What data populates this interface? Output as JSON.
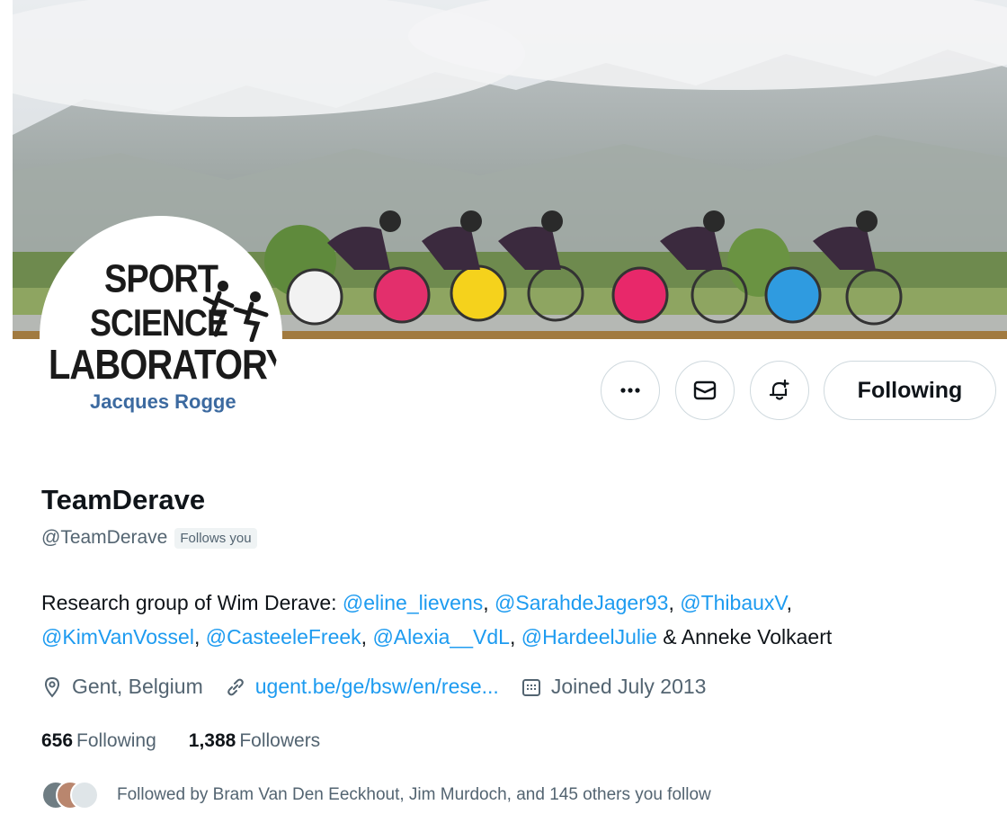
{
  "avatar": {
    "line1": "SPORT",
    "line2": "SCIENCE",
    "line3": "LABORATORY",
    "line4": "Jacques Rogge"
  },
  "actions": {
    "more_icon": "more-dots-icon",
    "message_icon": "envelope-icon",
    "notify_icon": "bell-plus-icon",
    "following_label": "Following"
  },
  "profile": {
    "display_name": "TeamDerave",
    "handle": "@TeamDerave",
    "follows_you": "Follows you",
    "bio": {
      "intro": "Research group of Wim Derave: ",
      "mentions": [
        "@eline_lievens",
        "@SarahdeJager93",
        "@ThibauxV",
        "@KimVanVossel",
        "@CasteeleFreek",
        "@Alexia__VdL",
        "@HardeelJulie"
      ],
      "outro": " & Anneke Volkaert"
    },
    "location": "Gent, Belgium",
    "website": "ugent.be/ge/bsw/en/rese...",
    "joined": "Joined July 2013",
    "following_count": "656",
    "following_label": "Following",
    "followers_count": "1,388",
    "followers_label": "Followers",
    "followed_by": "Followed by Bram Van Den Eeckhout, Jim Murdoch, and 145 others you follow"
  },
  "colors": {
    "accent": "#1d9bf0",
    "secondary_text": "#536471",
    "border": "#cfd9de"
  }
}
